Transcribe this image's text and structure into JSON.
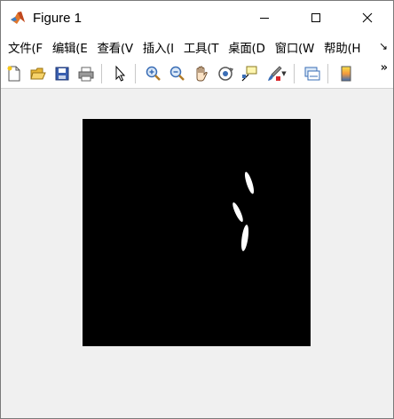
{
  "window": {
    "title": "Figure 1"
  },
  "menu": {
    "items": [
      "文件(F",
      "编辑(E",
      "查看(V",
      "插入(I",
      "工具(T",
      "桌面(D",
      "窗口(W",
      "帮助(H"
    ],
    "overflow_glyph": "↘"
  },
  "toolbar": {
    "overflow_glyph": "»",
    "buttons": [
      "new-figure-icon",
      "open-file-icon",
      "save-icon",
      "print-icon",
      "pointer-icon",
      "zoom-in-icon",
      "zoom-out-icon",
      "pan-hand-icon",
      "rotate-3d-icon",
      "data-cursor-icon",
      "brush-icon",
      "link-plot-icon",
      "colorbar-icon"
    ]
  },
  "image": {
    "background": "#000000",
    "foreground": "#ffffff",
    "description_shapes": "three white elongated blobs"
  },
  "colors": {
    "titlebar_bg": "#ffffff",
    "window_bg": "#f0f0f0",
    "axes_bg": "#000000"
  }
}
